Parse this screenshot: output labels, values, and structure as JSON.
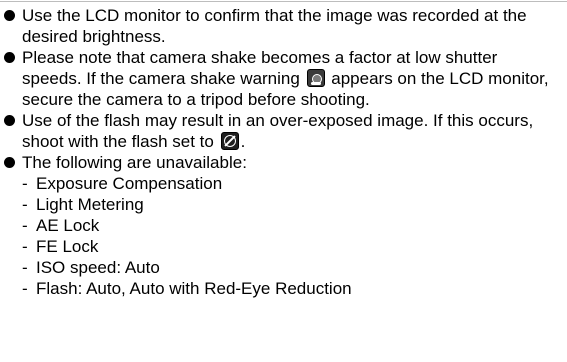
{
  "bullets": [
    {
      "text": "Use the LCD monitor to confirm that the image was recorded at the desired brightness."
    },
    {
      "text_before_icon": "Please note that camera shake becomes a factor at low shutter speeds. If the camera shake warning ",
      "icon": "camera-shake-warning-icon",
      "text_after_icon": " appears on the LCD monitor, secure the camera to a tripod before shooting."
    },
    {
      "text_before_icon": "Use of the flash may result in an over-exposed image. If this occurs, shoot with the flash set to ",
      "icon": "flash-off-icon",
      "text_after_icon": "."
    },
    {
      "text": "The following are unavailable:",
      "sub_items": [
        "Exposure Compensation",
        "Light Metering",
        "AE Lock",
        "FE Lock",
        "ISO speed: Auto",
        "Flash: Auto, Auto with Red-Eye Reduction"
      ]
    }
  ],
  "dash": "-"
}
